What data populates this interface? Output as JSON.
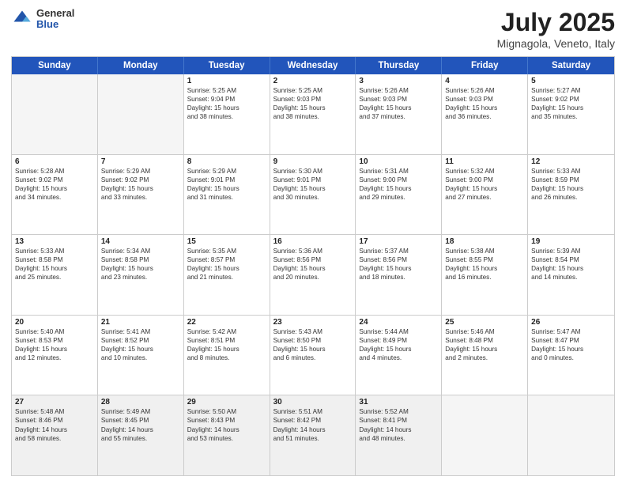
{
  "header": {
    "logo": {
      "general": "General",
      "blue": "Blue"
    },
    "title": "July 2025",
    "location": "Mignagola, Veneto, Italy"
  },
  "weekdays": [
    "Sunday",
    "Monday",
    "Tuesday",
    "Wednesday",
    "Thursday",
    "Friday",
    "Saturday"
  ],
  "rows": [
    [
      {
        "day": "",
        "sunrise": "",
        "sunset": "",
        "daylight": "",
        "empty": true
      },
      {
        "day": "",
        "sunrise": "",
        "sunset": "",
        "daylight": "",
        "empty": true
      },
      {
        "day": "1",
        "sunrise": "Sunrise: 5:25 AM",
        "sunset": "Sunset: 9:04 PM",
        "daylight": "Daylight: 15 hours and 38 minutes."
      },
      {
        "day": "2",
        "sunrise": "Sunrise: 5:25 AM",
        "sunset": "Sunset: 9:03 PM",
        "daylight": "Daylight: 15 hours and 38 minutes."
      },
      {
        "day": "3",
        "sunrise": "Sunrise: 5:26 AM",
        "sunset": "Sunset: 9:03 PM",
        "daylight": "Daylight: 15 hours and 37 minutes."
      },
      {
        "day": "4",
        "sunrise": "Sunrise: 5:26 AM",
        "sunset": "Sunset: 9:03 PM",
        "daylight": "Daylight: 15 hours and 36 minutes."
      },
      {
        "day": "5",
        "sunrise": "Sunrise: 5:27 AM",
        "sunset": "Sunset: 9:02 PM",
        "daylight": "Daylight: 15 hours and 35 minutes."
      }
    ],
    [
      {
        "day": "6",
        "sunrise": "Sunrise: 5:28 AM",
        "sunset": "Sunset: 9:02 PM",
        "daylight": "Daylight: 15 hours and 34 minutes."
      },
      {
        "day": "7",
        "sunrise": "Sunrise: 5:29 AM",
        "sunset": "Sunset: 9:02 PM",
        "daylight": "Daylight: 15 hours and 33 minutes."
      },
      {
        "day": "8",
        "sunrise": "Sunrise: 5:29 AM",
        "sunset": "Sunset: 9:01 PM",
        "daylight": "Daylight: 15 hours and 31 minutes."
      },
      {
        "day": "9",
        "sunrise": "Sunrise: 5:30 AM",
        "sunset": "Sunset: 9:01 PM",
        "daylight": "Daylight: 15 hours and 30 minutes."
      },
      {
        "day": "10",
        "sunrise": "Sunrise: 5:31 AM",
        "sunset": "Sunset: 9:00 PM",
        "daylight": "Daylight: 15 hours and 29 minutes."
      },
      {
        "day": "11",
        "sunrise": "Sunrise: 5:32 AM",
        "sunset": "Sunset: 9:00 PM",
        "daylight": "Daylight: 15 hours and 27 minutes."
      },
      {
        "day": "12",
        "sunrise": "Sunrise: 5:33 AM",
        "sunset": "Sunset: 8:59 PM",
        "daylight": "Daylight: 15 hours and 26 minutes."
      }
    ],
    [
      {
        "day": "13",
        "sunrise": "Sunrise: 5:33 AM",
        "sunset": "Sunset: 8:58 PM",
        "daylight": "Daylight: 15 hours and 25 minutes."
      },
      {
        "day": "14",
        "sunrise": "Sunrise: 5:34 AM",
        "sunset": "Sunset: 8:58 PM",
        "daylight": "Daylight: 15 hours and 23 minutes."
      },
      {
        "day": "15",
        "sunrise": "Sunrise: 5:35 AM",
        "sunset": "Sunset: 8:57 PM",
        "daylight": "Daylight: 15 hours and 21 minutes."
      },
      {
        "day": "16",
        "sunrise": "Sunrise: 5:36 AM",
        "sunset": "Sunset: 8:56 PM",
        "daylight": "Daylight: 15 hours and 20 minutes."
      },
      {
        "day": "17",
        "sunrise": "Sunrise: 5:37 AM",
        "sunset": "Sunset: 8:56 PM",
        "daylight": "Daylight: 15 hours and 18 minutes."
      },
      {
        "day": "18",
        "sunrise": "Sunrise: 5:38 AM",
        "sunset": "Sunset: 8:55 PM",
        "daylight": "Daylight: 15 hours and 16 minutes."
      },
      {
        "day": "19",
        "sunrise": "Sunrise: 5:39 AM",
        "sunset": "Sunset: 8:54 PM",
        "daylight": "Daylight: 15 hours and 14 minutes."
      }
    ],
    [
      {
        "day": "20",
        "sunrise": "Sunrise: 5:40 AM",
        "sunset": "Sunset: 8:53 PM",
        "daylight": "Daylight: 15 hours and 12 minutes."
      },
      {
        "day": "21",
        "sunrise": "Sunrise: 5:41 AM",
        "sunset": "Sunset: 8:52 PM",
        "daylight": "Daylight: 15 hours and 10 minutes."
      },
      {
        "day": "22",
        "sunrise": "Sunrise: 5:42 AM",
        "sunset": "Sunset: 8:51 PM",
        "daylight": "Daylight: 15 hours and 8 minutes."
      },
      {
        "day": "23",
        "sunrise": "Sunrise: 5:43 AM",
        "sunset": "Sunset: 8:50 PM",
        "daylight": "Daylight: 15 hours and 6 minutes."
      },
      {
        "day": "24",
        "sunrise": "Sunrise: 5:44 AM",
        "sunset": "Sunset: 8:49 PM",
        "daylight": "Daylight: 15 hours and 4 minutes."
      },
      {
        "day": "25",
        "sunrise": "Sunrise: 5:46 AM",
        "sunset": "Sunset: 8:48 PM",
        "daylight": "Daylight: 15 hours and 2 minutes."
      },
      {
        "day": "26",
        "sunrise": "Sunrise: 5:47 AM",
        "sunset": "Sunset: 8:47 PM",
        "daylight": "Daylight: 15 hours and 0 minutes."
      }
    ],
    [
      {
        "day": "27",
        "sunrise": "Sunrise: 5:48 AM",
        "sunset": "Sunset: 8:46 PM",
        "daylight": "Daylight: 14 hours and 58 minutes."
      },
      {
        "day": "28",
        "sunrise": "Sunrise: 5:49 AM",
        "sunset": "Sunset: 8:45 PM",
        "daylight": "Daylight: 14 hours and 55 minutes."
      },
      {
        "day": "29",
        "sunrise": "Sunrise: 5:50 AM",
        "sunset": "Sunset: 8:43 PM",
        "daylight": "Daylight: 14 hours and 53 minutes."
      },
      {
        "day": "30",
        "sunrise": "Sunrise: 5:51 AM",
        "sunset": "Sunset: 8:42 PM",
        "daylight": "Daylight: 14 hours and 51 minutes."
      },
      {
        "day": "31",
        "sunrise": "Sunrise: 5:52 AM",
        "sunset": "Sunset: 8:41 PM",
        "daylight": "Daylight: 14 hours and 48 minutes."
      },
      {
        "day": "",
        "sunrise": "",
        "sunset": "",
        "daylight": "",
        "empty": true
      },
      {
        "day": "",
        "sunrise": "",
        "sunset": "",
        "daylight": "",
        "empty": true
      }
    ]
  ]
}
